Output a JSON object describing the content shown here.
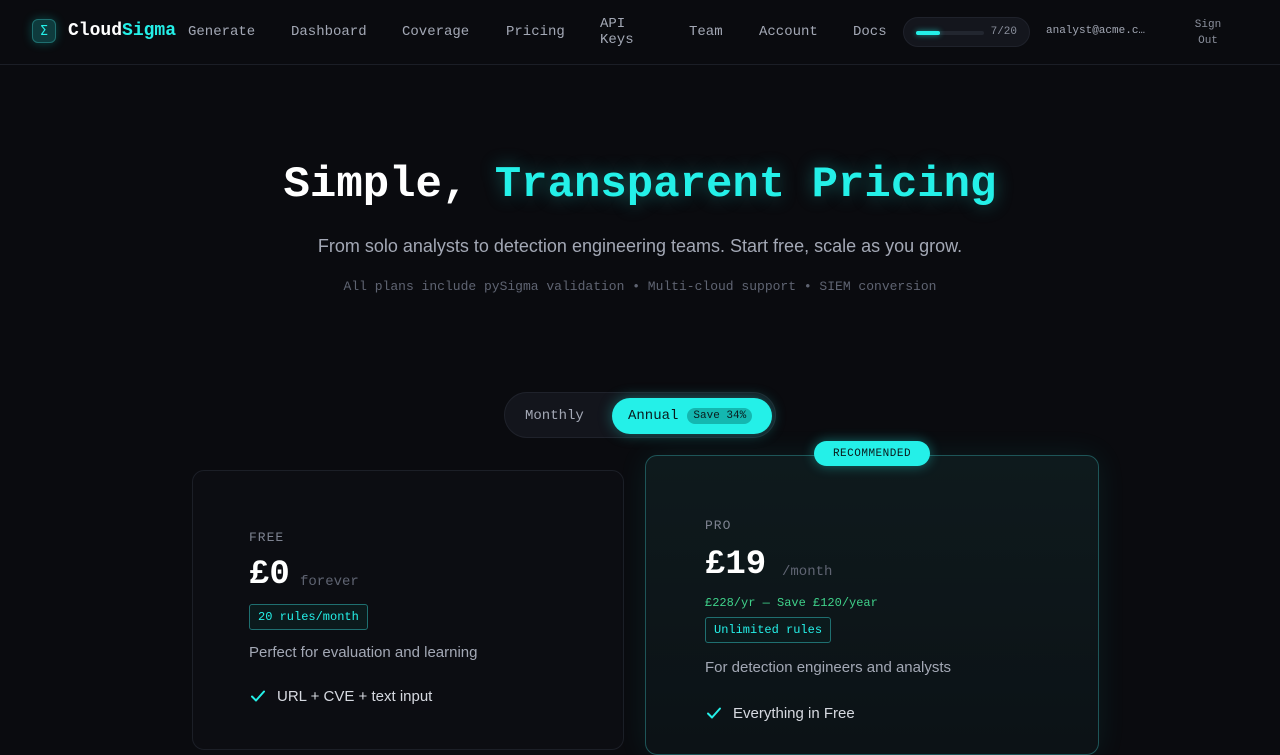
{
  "brand": {
    "name_part1": "Cloud",
    "name_part2": "Sigma",
    "mark": "Σ",
    "accent_color": "#24f0e8"
  },
  "nav": {
    "links": [
      {
        "label": "Generate"
      },
      {
        "label": "Dashboard"
      },
      {
        "label": "Coverage"
      },
      {
        "label": "Pricing"
      },
      {
        "label": "API Keys"
      },
      {
        "label": "Team"
      },
      {
        "label": "Account"
      },
      {
        "label": "Docs"
      }
    ],
    "usage": {
      "label": "7/20",
      "used": 7,
      "limit": 20
    },
    "email": "analyst@acme.c…",
    "signout": "Sign Out"
  },
  "hero": {
    "title_plain": "Simple, ",
    "title_accent": "Transparent Pricing",
    "subtitle": "From solo analysts to detection engineering teams. Start free, scale as you grow.",
    "note": "All plans include pySigma validation • Multi-cloud support • SIEM conversion"
  },
  "billing_toggle": {
    "monthly_label": "Monthly",
    "annual_label": "Annual",
    "save_badge": "Save 34%",
    "selected": "Annual"
  },
  "plans": [
    {
      "tier": "FREE",
      "price": "£0",
      "period": "forever",
      "quota": "20 rules/month",
      "description": "Perfect for evaluation and learning",
      "features": [
        "URL + CVE + text input"
      ]
    },
    {
      "ribbon": "RECOMMENDED",
      "tier": "PRO",
      "price": "£19",
      "period": "/month",
      "annual_note": "£228/yr — Save £120/year",
      "quota": "Unlimited rules",
      "description": "For detection engineers and analysts",
      "features": [
        "Everything in Free"
      ]
    }
  ]
}
